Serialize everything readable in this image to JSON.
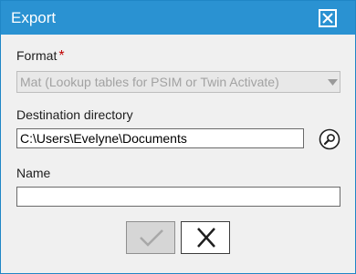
{
  "dialog": {
    "title": "Export",
    "format": {
      "label": "Format",
      "required_mark": "*",
      "selected": "Mat (Lookup tables for PSIM or Twin Activate)"
    },
    "destination": {
      "label": "Destination directory",
      "value": "C:\\Users\\Evelyne\\Documents"
    },
    "name": {
      "label": "Name",
      "value": ""
    }
  },
  "colors": {
    "titlebar": "#2a92d2",
    "required": "#c00000",
    "ok_disabled_bg": "#d6d6d6"
  },
  "icons": [
    "close-icon",
    "chevron-down-icon",
    "search-icon",
    "checkmark-icon",
    "cancel-x-icon"
  ]
}
